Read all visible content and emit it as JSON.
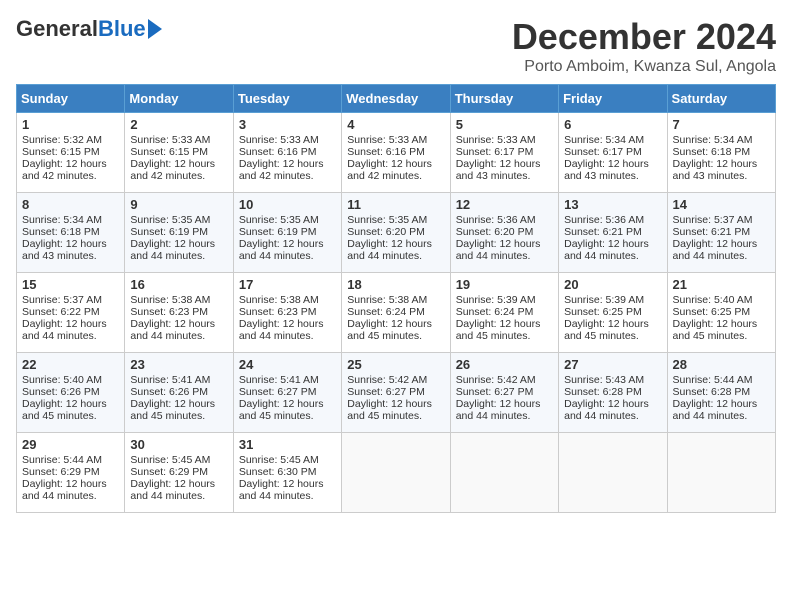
{
  "logo": {
    "general": "General",
    "blue": "Blue"
  },
  "header": {
    "month": "December 2024",
    "location": "Porto Amboim, Kwanza Sul, Angola"
  },
  "days_of_week": [
    "Sunday",
    "Monday",
    "Tuesday",
    "Wednesday",
    "Thursday",
    "Friday",
    "Saturday"
  ],
  "weeks": [
    [
      {
        "day": 1,
        "sunrise": "5:32 AM",
        "sunset": "6:15 PM",
        "daylight": "12 hours and 42 minutes."
      },
      {
        "day": 2,
        "sunrise": "5:33 AM",
        "sunset": "6:15 PM",
        "daylight": "12 hours and 42 minutes."
      },
      {
        "day": 3,
        "sunrise": "5:33 AM",
        "sunset": "6:16 PM",
        "daylight": "12 hours and 42 minutes."
      },
      {
        "day": 4,
        "sunrise": "5:33 AM",
        "sunset": "6:16 PM",
        "daylight": "12 hours and 42 minutes."
      },
      {
        "day": 5,
        "sunrise": "5:33 AM",
        "sunset": "6:17 PM",
        "daylight": "12 hours and 43 minutes."
      },
      {
        "day": 6,
        "sunrise": "5:34 AM",
        "sunset": "6:17 PM",
        "daylight": "12 hours and 43 minutes."
      },
      {
        "day": 7,
        "sunrise": "5:34 AM",
        "sunset": "6:18 PM",
        "daylight": "12 hours and 43 minutes."
      }
    ],
    [
      {
        "day": 8,
        "sunrise": "5:34 AM",
        "sunset": "6:18 PM",
        "daylight": "12 hours and 43 minutes."
      },
      {
        "day": 9,
        "sunrise": "5:35 AM",
        "sunset": "6:19 PM",
        "daylight": "12 hours and 44 minutes."
      },
      {
        "day": 10,
        "sunrise": "5:35 AM",
        "sunset": "6:19 PM",
        "daylight": "12 hours and 44 minutes."
      },
      {
        "day": 11,
        "sunrise": "5:35 AM",
        "sunset": "6:20 PM",
        "daylight": "12 hours and 44 minutes."
      },
      {
        "day": 12,
        "sunrise": "5:36 AM",
        "sunset": "6:20 PM",
        "daylight": "12 hours and 44 minutes."
      },
      {
        "day": 13,
        "sunrise": "5:36 AM",
        "sunset": "6:21 PM",
        "daylight": "12 hours and 44 minutes."
      },
      {
        "day": 14,
        "sunrise": "5:37 AM",
        "sunset": "6:21 PM",
        "daylight": "12 hours and 44 minutes."
      }
    ],
    [
      {
        "day": 15,
        "sunrise": "5:37 AM",
        "sunset": "6:22 PM",
        "daylight": "12 hours and 44 minutes."
      },
      {
        "day": 16,
        "sunrise": "5:38 AM",
        "sunset": "6:23 PM",
        "daylight": "12 hours and 44 minutes."
      },
      {
        "day": 17,
        "sunrise": "5:38 AM",
        "sunset": "6:23 PM",
        "daylight": "12 hours and 44 minutes."
      },
      {
        "day": 18,
        "sunrise": "5:38 AM",
        "sunset": "6:24 PM",
        "daylight": "12 hours and 45 minutes."
      },
      {
        "day": 19,
        "sunrise": "5:39 AM",
        "sunset": "6:24 PM",
        "daylight": "12 hours and 45 minutes."
      },
      {
        "day": 20,
        "sunrise": "5:39 AM",
        "sunset": "6:25 PM",
        "daylight": "12 hours and 45 minutes."
      },
      {
        "day": 21,
        "sunrise": "5:40 AM",
        "sunset": "6:25 PM",
        "daylight": "12 hours and 45 minutes."
      }
    ],
    [
      {
        "day": 22,
        "sunrise": "5:40 AM",
        "sunset": "6:26 PM",
        "daylight": "12 hours and 45 minutes."
      },
      {
        "day": 23,
        "sunrise": "5:41 AM",
        "sunset": "6:26 PM",
        "daylight": "12 hours and 45 minutes."
      },
      {
        "day": 24,
        "sunrise": "5:41 AM",
        "sunset": "6:27 PM",
        "daylight": "12 hours and 45 minutes."
      },
      {
        "day": 25,
        "sunrise": "5:42 AM",
        "sunset": "6:27 PM",
        "daylight": "12 hours and 45 minutes."
      },
      {
        "day": 26,
        "sunrise": "5:42 AM",
        "sunset": "6:27 PM",
        "daylight": "12 hours and 44 minutes."
      },
      {
        "day": 27,
        "sunrise": "5:43 AM",
        "sunset": "6:28 PM",
        "daylight": "12 hours and 44 minutes."
      },
      {
        "day": 28,
        "sunrise": "5:44 AM",
        "sunset": "6:28 PM",
        "daylight": "12 hours and 44 minutes."
      }
    ],
    [
      {
        "day": 29,
        "sunrise": "5:44 AM",
        "sunset": "6:29 PM",
        "daylight": "12 hours and 44 minutes."
      },
      {
        "day": 30,
        "sunrise": "5:45 AM",
        "sunset": "6:29 PM",
        "daylight": "12 hours and 44 minutes."
      },
      {
        "day": 31,
        "sunrise": "5:45 AM",
        "sunset": "6:30 PM",
        "daylight": "12 hours and 44 minutes."
      },
      null,
      null,
      null,
      null
    ]
  ],
  "labels": {
    "sunrise": "Sunrise:",
    "sunset": "Sunset:",
    "daylight": "Daylight:"
  }
}
